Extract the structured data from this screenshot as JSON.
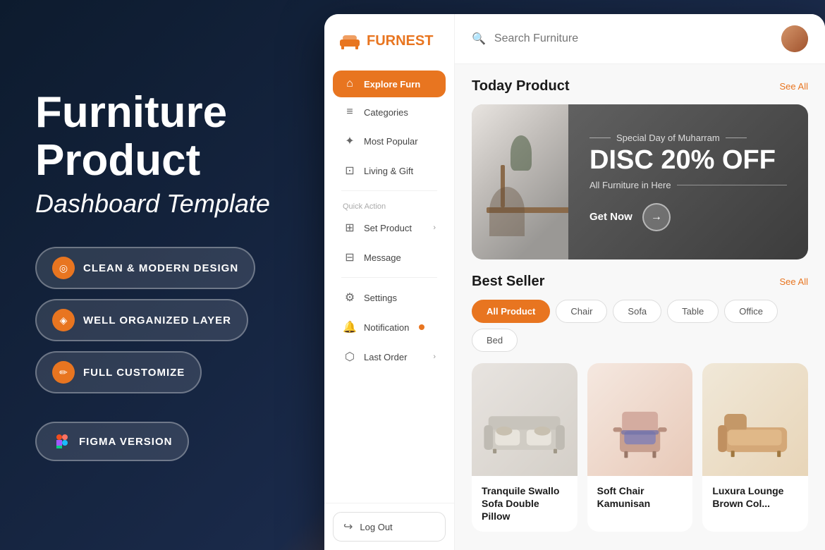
{
  "promo": {
    "title": "Furniture",
    "title2": "Product",
    "subtitle": "Dashboard Template",
    "features": [
      {
        "id": "feat1",
        "icon": "◎",
        "label": "CLEAN & MODERN DESIGN"
      },
      {
        "id": "feat2",
        "icon": "◈",
        "label": "WELL ORGANIZED LAYER"
      },
      {
        "id": "feat3",
        "icon": "✏",
        "label": "FULL CUSTOMIZE"
      }
    ],
    "figma": {
      "icon": "F",
      "label": "FIGMA VERSION"
    }
  },
  "logo": {
    "part1": "FURN",
    "part2": "EST"
  },
  "sidebar": {
    "nav_items": [
      {
        "id": "explore",
        "icon": "⌂",
        "label": "Explore Furn",
        "active": true,
        "hasChevron": false
      },
      {
        "id": "categories",
        "icon": "≡",
        "label": "Categories",
        "active": false,
        "hasChevron": false
      },
      {
        "id": "popular",
        "icon": "✦",
        "label": "Most Popular",
        "active": false,
        "hasChevron": false
      },
      {
        "id": "living",
        "icon": "⊡",
        "label": "Living & Gift",
        "active": false,
        "hasChevron": false
      }
    ],
    "quick_action_label": "Quick Action",
    "quick_items": [
      {
        "id": "setproduct",
        "icon": "⊞",
        "label": "Set Product",
        "hasChevron": true
      },
      {
        "id": "message",
        "icon": "⊟",
        "label": "Message",
        "hasChevron": false
      }
    ],
    "bottom_items": [
      {
        "id": "settings",
        "icon": "⚙",
        "label": "Settings",
        "hasChevron": false
      },
      {
        "id": "notification",
        "icon": "🔔",
        "label": "Notification",
        "hasChevron": false,
        "hasDot": true
      },
      {
        "id": "lastorder",
        "icon": "⬡",
        "label": "Last Order",
        "hasChevron": true
      }
    ],
    "logout": "Log Out"
  },
  "header": {
    "search_placeholder": "Search Furniture"
  },
  "today_product": {
    "title": "Today Product",
    "see_all": "See All",
    "banner": {
      "special_label": "Special Day of Muharram",
      "discount_title": "DISC 20% OFF",
      "description": "All Furniture in Here",
      "cta": "Get Now"
    }
  },
  "best_seller": {
    "title": "Best Seller",
    "see_all": "See All",
    "filters": [
      {
        "id": "all",
        "label": "All Product",
        "active": true
      },
      {
        "id": "chair",
        "label": "Chair",
        "active": false
      },
      {
        "id": "sofa",
        "label": "Sofa",
        "active": false
      },
      {
        "id": "table",
        "label": "Table",
        "active": false
      },
      {
        "id": "office",
        "label": "Office",
        "active": false
      },
      {
        "id": "bed",
        "label": "Bed",
        "active": false
      }
    ],
    "products": [
      {
        "id": "prod1",
        "name": "Tranquile Swallo Sofa Double Pillow",
        "type": "sofa"
      },
      {
        "id": "prod2",
        "name": "Soft Chair Kamunisan",
        "type": "chair"
      },
      {
        "id": "prod3",
        "name": "Luxura Lounge Brown Col...",
        "type": "lounge"
      }
    ]
  }
}
